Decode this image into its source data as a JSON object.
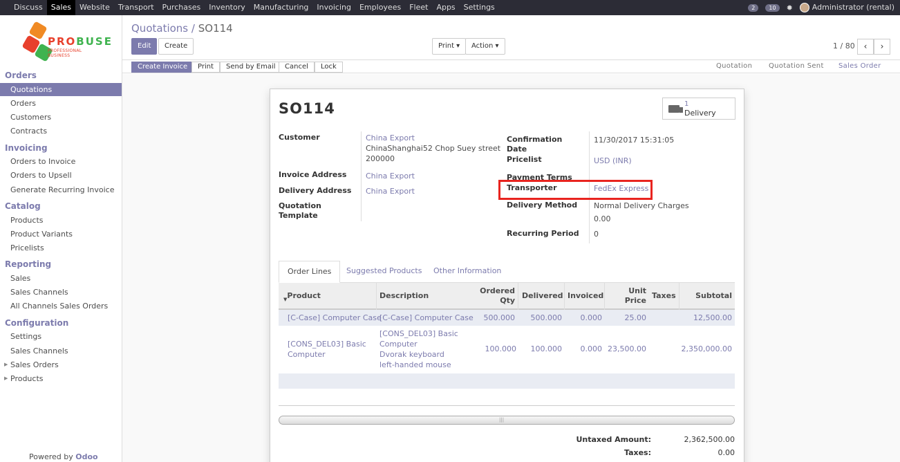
{
  "topbar": {
    "menu": [
      "Discuss",
      "Sales",
      "Website",
      "Transport",
      "Purchases",
      "Inventory",
      "Manufacturing",
      "Invoicing",
      "Employees",
      "Fleet",
      "Apps",
      "Settings"
    ],
    "active": "Sales",
    "chat_count": "2",
    "activity_count": "10",
    "user": "Administrator (rental)"
  },
  "logo": {
    "brand_a": "PRO",
    "brand_b": "BUSE",
    "tagline": "PROFESSIONAL BUSINESS"
  },
  "sidebar": {
    "sections": [
      {
        "title": "Orders",
        "items": [
          "Quotations",
          "Orders",
          "Customers",
          "Contracts"
        ]
      },
      {
        "title": "Invoicing",
        "items": [
          "Orders to Invoice",
          "Orders to Upsell",
          "Generate Recurring Invoice"
        ]
      },
      {
        "title": "Catalog",
        "items": [
          "Products",
          "Product Variants",
          "Pricelists"
        ]
      },
      {
        "title": "Reporting",
        "items": [
          "Sales",
          "Sales Channels",
          "All Channels Sales Orders"
        ]
      },
      {
        "title": "Configuration",
        "items": [
          "Settings",
          "Sales Channels",
          "Sales Orders",
          "Products"
        ]
      }
    ],
    "powered_prefix": "Powered by",
    "powered_brand": "Odoo"
  },
  "breadcrumb": {
    "parent": "Quotations",
    "separator": "/",
    "current": "SO114"
  },
  "controls": {
    "edit": "Edit",
    "create": "Create",
    "print": "Print ▾",
    "action": "Action ▾",
    "pager": "1 / 80",
    "prev": "‹",
    "next": "›"
  },
  "statusbar": {
    "buttons": [
      "Create Invoice",
      "Print",
      "Send by Email",
      "Cancel",
      "Lock"
    ],
    "stages": [
      "Quotation",
      "Quotation Sent",
      "Sales Order"
    ],
    "active_stage": "Sales Order"
  },
  "form": {
    "name": "SO114",
    "delivery_count": "1",
    "delivery_label": "Delivery",
    "customer_label": "Customer",
    "customer_name": "China Export",
    "customer_address_1": "ChinaShanghai52 Chop Suey street",
    "customer_address_2": "200000",
    "invoice_address_label": "Invoice Address",
    "invoice_address": "China Export",
    "delivery_address_label": "Delivery Address",
    "delivery_address": "China Export",
    "template_label_1": "Quotation",
    "template_label_2": "Template",
    "confirmation_label_1": "Confirmation",
    "confirmation_label_2": "Date",
    "confirmation_date": "11/30/2017 15:31:05",
    "pricelist_label": "Pricelist",
    "pricelist": "USD (INR)",
    "payment_terms_label": "Payment Terms",
    "transporter_label": "Transporter",
    "transporter": "FedEx Express",
    "delivery_method_label": "Delivery Method",
    "delivery_method": "Normal Delivery Charges",
    "delivery_method_amount": "0.00",
    "recurring_label": "Recurring Period",
    "recurring": "0"
  },
  "tabs": [
    "Order Lines",
    "Suggested Products",
    "Other Information"
  ],
  "table": {
    "headers": {
      "product": "Product",
      "description": "Description",
      "qty_1": "Ordered",
      "qty_2": "Qty",
      "delivered": "Delivered",
      "invoiced": "Invoiced",
      "price_1": "Unit",
      "price_2": "Price",
      "taxes": "Taxes",
      "subtotal": "Subtotal"
    },
    "rows": [
      {
        "product": "[C-Case] Computer Case",
        "description": "[C-Case] Computer Case",
        "qty": "500.000",
        "delivered": "500.000",
        "invoiced": "0.000",
        "price": "25.00",
        "subtotal": "12,500.00"
      },
      {
        "product_1": "[CONS_DEL03] Basic",
        "product_2": "Computer",
        "description_1": "[CONS_DEL03] Basic",
        "description_2": "Computer",
        "description_3": "Dvorak keyboard",
        "description_4": "left-handed mouse",
        "qty": "100.000",
        "delivered": "100.000",
        "invoiced": "0.000",
        "price": "23,500.00",
        "subtotal": "2,350,000.00"
      }
    ]
  },
  "totals": {
    "untaxed_label": "Untaxed Amount:",
    "untaxed": "2,362,500.00",
    "taxes_label": "Taxes:",
    "taxes": "0.00"
  },
  "colors": {
    "accent": "#7c7bad",
    "highlight": "#e8241f",
    "topbar": "#2c2c36"
  },
  "icons": [
    "truck-icon",
    "chat-icon",
    "activity-icon",
    "bug-icon",
    "sort-caret-icon"
  ]
}
